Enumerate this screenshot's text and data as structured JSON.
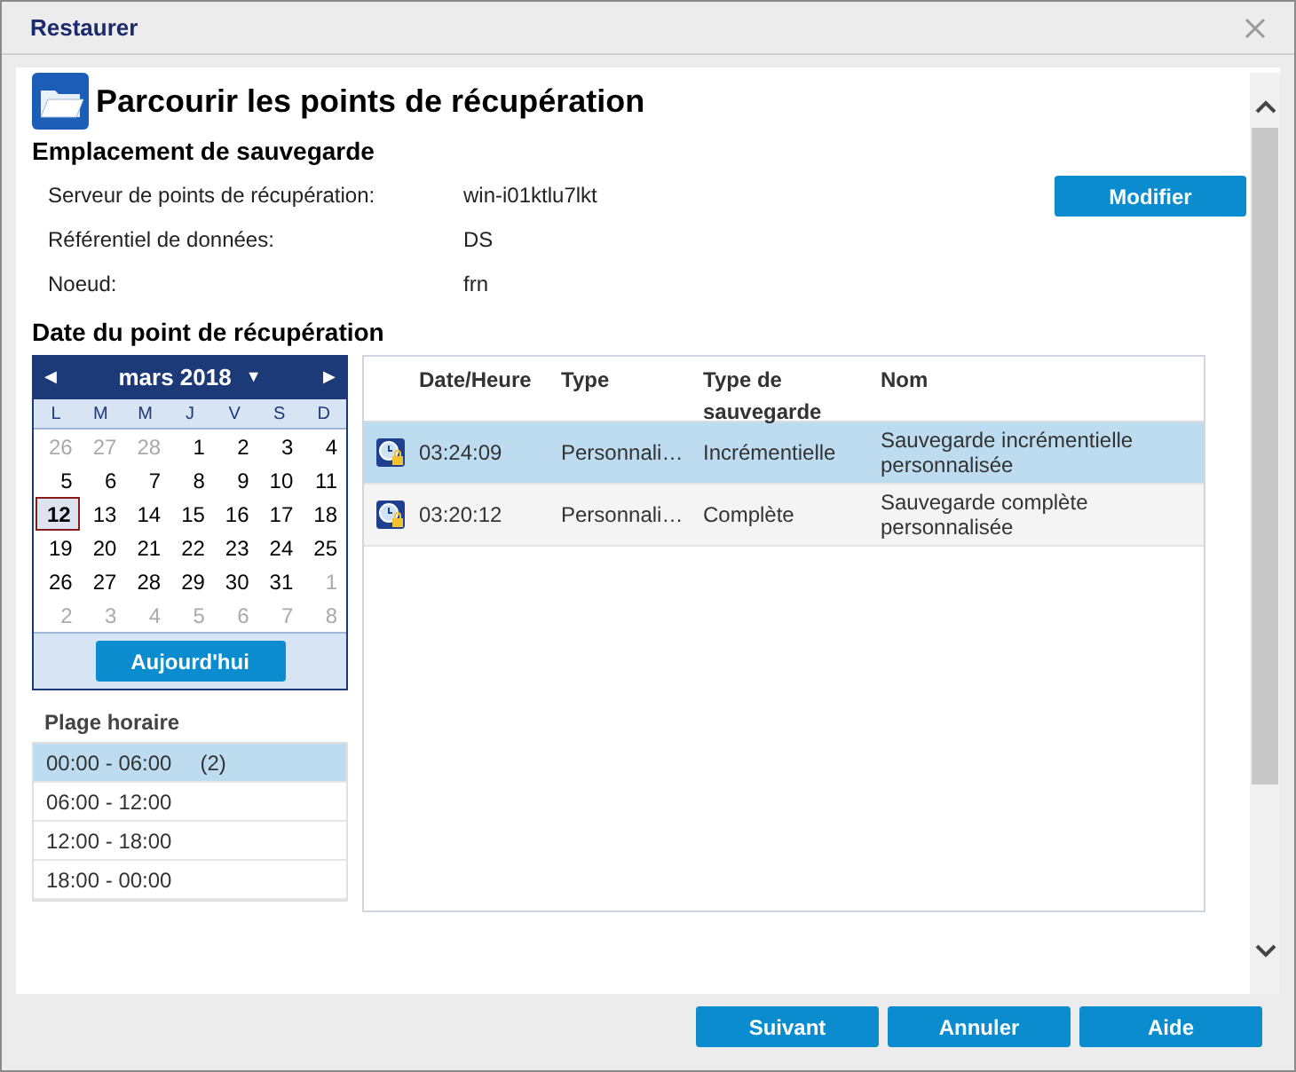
{
  "window": {
    "title": "Restaurer"
  },
  "header": {
    "title": "Parcourir les points de récupération"
  },
  "location": {
    "title": "Emplacement de sauvegarde",
    "button": "Modifier",
    "fields": [
      {
        "label": "Serveur de points de récupération:",
        "value": "win-i01ktlu7lkt"
      },
      {
        "label": "Référentiel de données:",
        "value": "DS"
      },
      {
        "label": "Noeud:",
        "value": "frn"
      }
    ]
  },
  "date_section": {
    "title": "Date du point de récupération"
  },
  "calendar": {
    "prev": "◀",
    "month": "mars 2018",
    "dropdown": "▼",
    "next": "▶",
    "weekdays": [
      "L",
      "M",
      "M",
      "J",
      "V",
      "S",
      "D"
    ],
    "days": [
      {
        "label": "26",
        "other": true,
        "selected": false
      },
      {
        "label": "27",
        "other": true,
        "selected": false
      },
      {
        "label": "28",
        "other": true,
        "selected": false
      },
      {
        "label": "1",
        "other": false,
        "selected": false
      },
      {
        "label": "2",
        "other": false,
        "selected": false
      },
      {
        "label": "3",
        "other": false,
        "selected": false
      },
      {
        "label": "4",
        "other": false,
        "selected": false
      },
      {
        "label": "5",
        "other": false,
        "selected": false
      },
      {
        "label": "6",
        "other": false,
        "selected": false
      },
      {
        "label": "7",
        "other": false,
        "selected": false
      },
      {
        "label": "8",
        "other": false,
        "selected": false
      },
      {
        "label": "9",
        "other": false,
        "selected": false
      },
      {
        "label": "10",
        "other": false,
        "selected": false
      },
      {
        "label": "11",
        "other": false,
        "selected": false
      },
      {
        "label": "12",
        "other": false,
        "selected": true
      },
      {
        "label": "13",
        "other": false,
        "selected": false
      },
      {
        "label": "14",
        "other": false,
        "selected": false
      },
      {
        "label": "15",
        "other": false,
        "selected": false
      },
      {
        "label": "16",
        "other": false,
        "selected": false
      },
      {
        "label": "17",
        "other": false,
        "selected": false
      },
      {
        "label": "18",
        "other": false,
        "selected": false
      },
      {
        "label": "19",
        "other": false,
        "selected": false
      },
      {
        "label": "20",
        "other": false,
        "selected": false
      },
      {
        "label": "21",
        "other": false,
        "selected": false
      },
      {
        "label": "22",
        "other": false,
        "selected": false
      },
      {
        "label": "23",
        "other": false,
        "selected": false
      },
      {
        "label": "24",
        "other": false,
        "selected": false
      },
      {
        "label": "25",
        "other": false,
        "selected": false
      },
      {
        "label": "26",
        "other": false,
        "selected": false
      },
      {
        "label": "27",
        "other": false,
        "selected": false
      },
      {
        "label": "28",
        "other": false,
        "selected": false
      },
      {
        "label": "29",
        "other": false,
        "selected": false
      },
      {
        "label": "30",
        "other": false,
        "selected": false
      },
      {
        "label": "31",
        "other": false,
        "selected": false
      },
      {
        "label": "1",
        "other": true,
        "selected": false
      },
      {
        "label": "2",
        "other": true,
        "selected": false
      },
      {
        "label": "3",
        "other": true,
        "selected": false
      },
      {
        "label": "4",
        "other": true,
        "selected": false
      },
      {
        "label": "5",
        "other": true,
        "selected": false
      },
      {
        "label": "6",
        "other": true,
        "selected": false
      },
      {
        "label": "7",
        "other": true,
        "selected": false
      },
      {
        "label": "8",
        "other": true,
        "selected": false
      }
    ],
    "today": "Aujourd'hui"
  },
  "time_ranges": {
    "title": "Plage horaire",
    "items": [
      {
        "label": "00:00 - 06:00",
        "count": "(2)",
        "selected": true
      },
      {
        "label": "06:00 - 12:00",
        "selected": false
      },
      {
        "label": "12:00 - 18:00",
        "selected": false
      },
      {
        "label": "18:00 - 00:00",
        "selected": false
      }
    ]
  },
  "table": {
    "columns": [
      "Date/Heure",
      "Type",
      "Type de sauvegarde",
      "Nom"
    ],
    "rows": [
      {
        "time": "03:24:09",
        "type": "Personnali…",
        "backup_type": "Incrémentielle",
        "name": "Sauvegarde incrémentielle personnalisée",
        "selected": true
      },
      {
        "time": "03:20:12",
        "type": "Personnali…",
        "backup_type": "Complète",
        "name": "Sauvegarde complète personnalisée",
        "selected": false
      }
    ]
  },
  "buttons": [
    "Suivant",
    "Annuler",
    "Aide"
  ]
}
